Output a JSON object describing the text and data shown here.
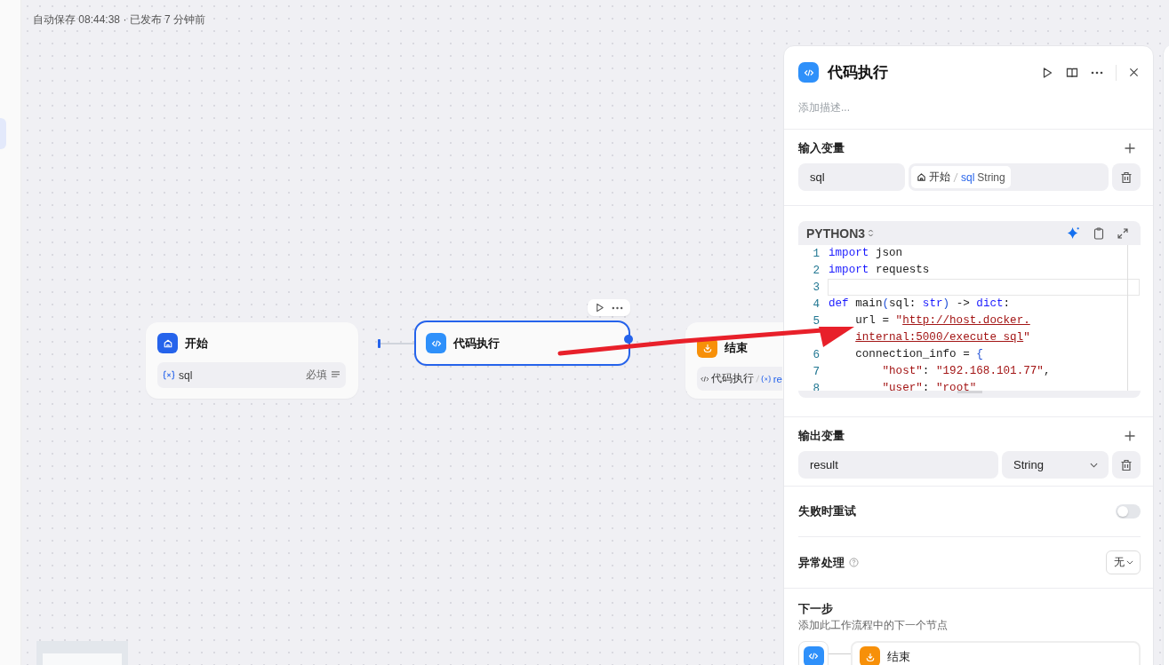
{
  "status": "自动保存 08:44:38 · 已发布 7 分钟前",
  "nodes": [
    {
      "kind": "start",
      "title": "开始",
      "selected": false,
      "variables": [
        {
          "name": "sql",
          "required": "必填"
        }
      ]
    },
    {
      "kind": "code",
      "title": "代码执行",
      "selected": true
    },
    {
      "kind": "end",
      "title": "结束",
      "selected": false,
      "refs": [
        {
          "node": "代码执行",
          "variable": "re"
        }
      ]
    }
  ],
  "panel": {
    "title": "代码执行",
    "description_placeholder": "添加描述...",
    "inputs": {
      "title": "输入变量",
      "rows": [
        {
          "name": "sql",
          "source_node": "开始",
          "variable": "sql",
          "type": "String"
        }
      ]
    },
    "code": {
      "language": "PYTHON3",
      "lines": [
        {
          "number": "1",
          "active": false,
          "tokens": [
            {
              "kind": "keyword",
              "text": "import"
            },
            {
              "kind": "plain",
              "text": " json"
            }
          ]
        },
        {
          "number": "2",
          "active": false,
          "tokens": [
            {
              "kind": "keyword",
              "text": "import"
            },
            {
              "kind": "plain",
              "text": " requests"
            }
          ]
        },
        {
          "number": "3",
          "active": true
        },
        {
          "number": "4",
          "active": false,
          "tokens": [
            {
              "kind": "keyword",
              "text": "def"
            },
            {
              "kind": "plain",
              "text": " main"
            },
            {
              "kind": "bracket",
              "text": "("
            },
            {
              "kind": "plain",
              "text": "sql: "
            },
            {
              "kind": "keyword",
              "text": "str"
            },
            {
              "kind": "bracket",
              "text": ")"
            },
            {
              "kind": "plain",
              "text": " -> "
            },
            {
              "kind": "keyword",
              "text": "dict"
            },
            {
              "kind": "plain",
              "text": ":"
            }
          ]
        },
        {
          "number": "5",
          "active": false,
          "tokens": [
            {
              "kind": "plain",
              "text": "    url = "
            },
            {
              "kind": "string",
              "text": "\""
            },
            {
              "kind": "link",
              "text": "http://host.docker."
            }
          ]
        },
        {
          "active": false,
          "tokens": [
            {
              "kind": "link",
              "text": "    internal:5000/execute_sql"
            },
            {
              "kind": "string",
              "text": "\""
            }
          ]
        },
        {
          "number": "6",
          "active": false,
          "tokens": [
            {
              "kind": "plain",
              "text": "    connection_info = "
            },
            {
              "kind": "bracket",
              "text": "{"
            }
          ]
        },
        {
          "number": "7",
          "active": false,
          "tokens": [
            {
              "kind": "string",
              "text": "        \"host\""
            },
            {
              "kind": "plain",
              "text": ": "
            },
            {
              "kind": "string",
              "text": "\"192.168.101.77\""
            },
            {
              "kind": "plain",
              "text": ","
            }
          ]
        },
        {
          "number": "8",
          "active": false,
          "tokens": [
            {
              "kind": "string",
              "text": "        \"user\""
            },
            {
              "kind": "plain",
              "text": ": "
            },
            {
              "kind": "string",
              "text": "\"root\""
            }
          ]
        }
      ]
    },
    "outputs": {
      "title": "输出变量",
      "rows": [
        {
          "name": "result",
          "type": "String"
        }
      ]
    },
    "retry": {
      "label": "失败时重试",
      "on": false
    },
    "error_handling": {
      "label": "异常处理",
      "value": "无"
    },
    "next": {
      "title": "下一步",
      "subtitle": "添加此工作流程中的下一个节点",
      "nodes": [
        {
          "kind": "end",
          "title": "结束"
        }
      ]
    }
  }
}
